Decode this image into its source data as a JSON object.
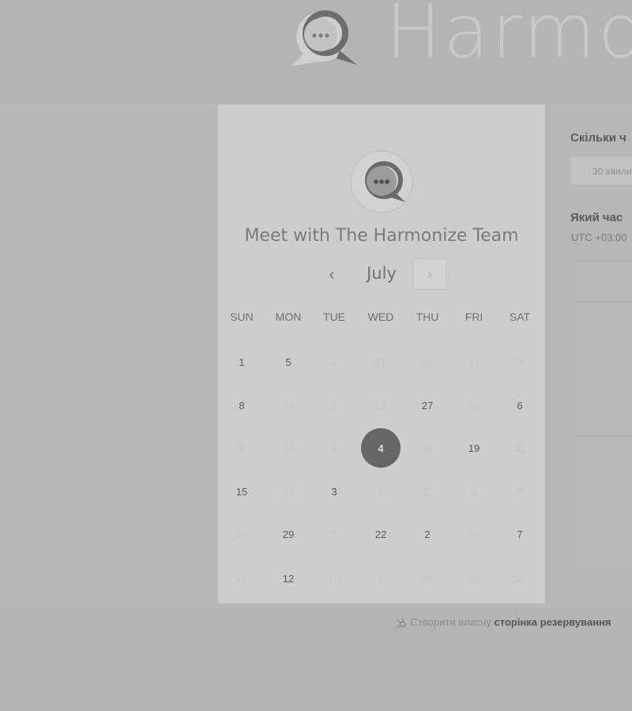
{
  "brand": {
    "name": "Harmo",
    "logo_icon": "chat-bubble-logo-icon"
  },
  "booking_card": {
    "title": "Meet with The Harmonize Team",
    "month": "July",
    "prev_icon": "‹",
    "next_icon": "›",
    "weekdays": [
      "SUN",
      "MON",
      "TUE",
      "WED",
      "THU",
      "FRI",
      "SAT"
    ],
    "weeks": [
      [
        {
          "d": "1",
          "available": true
        },
        {
          "d": "5",
          "available": true
        },
        {
          "d": "4",
          "available": false
        },
        {
          "d": "21",
          "available": false
        },
        {
          "d": "29",
          "available": false
        },
        {
          "d": "17",
          "available": false
        },
        {
          "d": "28",
          "available": false
        }
      ],
      [
        {
          "d": "8",
          "available": true
        },
        {
          "d": "14",
          "available": false
        },
        {
          "d": "6",
          "available": false
        },
        {
          "d": "13",
          "available": false
        },
        {
          "d": "27",
          "available": true
        },
        {
          "d": "16",
          "available": false
        },
        {
          "d": "6",
          "available": true
        }
      ],
      [
        {
          "d": "9",
          "available": false
        },
        {
          "d": "31",
          "available": false
        },
        {
          "d": "4",
          "available": false
        },
        {
          "d": "4",
          "available": true,
          "selected": true
        },
        {
          "d": "18",
          "available": false
        },
        {
          "d": "19",
          "available": true
        },
        {
          "d": "21",
          "available": false
        }
      ],
      [
        {
          "d": "15",
          "available": true
        },
        {
          "d": "24",
          "available": false
        },
        {
          "d": "3",
          "available": true
        },
        {
          "d": "2",
          "available": false
        },
        {
          "d": "12",
          "available": false
        },
        {
          "d": "8",
          "available": false
        },
        {
          "d": "20",
          "available": false
        }
      ],
      [
        {
          "d": "14",
          "available": false
        },
        {
          "d": "29",
          "available": true
        },
        {
          "d": "5",
          "available": false
        },
        {
          "d": "22",
          "available": true
        },
        {
          "d": "2",
          "available": true
        },
        {
          "d": "9",
          "available": false
        },
        {
          "d": "7",
          "available": true
        }
      ],
      [
        {
          "d": "24",
          "available": false
        },
        {
          "d": "12",
          "available": true
        },
        {
          "d": "19",
          "available": false
        },
        {
          "d": "2",
          "available": false
        },
        {
          "d": "28",
          "available": false
        },
        {
          "d": "21",
          "available": false
        },
        {
          "d": "21",
          "available": false
        }
      ]
    ]
  },
  "side_panel": {
    "duration_label": "Скільки ч",
    "duration_value": "30 хвили",
    "time_label": "Який час",
    "timezone": "UTC +03:00"
  },
  "footer": {
    "text": "Створити власну",
    "link": "сторінка резервування"
  }
}
